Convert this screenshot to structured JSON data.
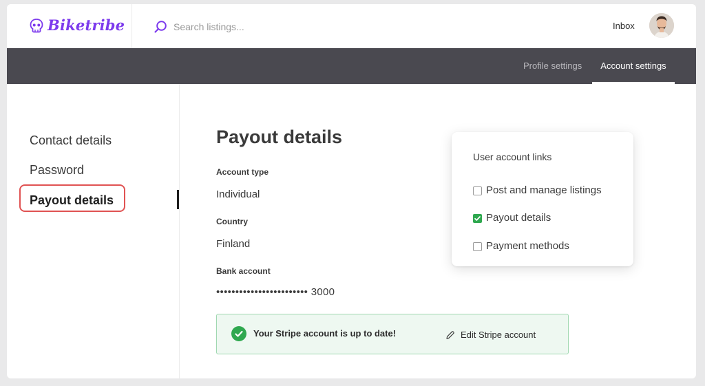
{
  "app": {
    "name": "Biketribe",
    "brand_color": "#7c3aed"
  },
  "search": {
    "placeholder": "Search listings..."
  },
  "topbar": {
    "inbox_label": "Inbox"
  },
  "subnav": {
    "tabs": [
      {
        "label": "Profile settings",
        "active": false
      },
      {
        "label": "Account settings",
        "active": true
      }
    ]
  },
  "sidebar": {
    "items": [
      {
        "label": "Contact details",
        "active": false
      },
      {
        "label": "Password",
        "active": false
      },
      {
        "label": "Payout details",
        "active": true
      }
    ]
  },
  "main": {
    "title": "Payout details",
    "fields": [
      {
        "label": "Account type",
        "value": "Individual"
      },
      {
        "label": "Country",
        "value": "Finland"
      },
      {
        "label": "Bank account",
        "value": "•••••••••••••••••••••••• 3000"
      }
    ],
    "stripe": {
      "message": "Your Stripe account is up to date!",
      "edit_label": "Edit Stripe account",
      "status_color": "#2fa84f"
    }
  },
  "popup": {
    "title": "User account links",
    "items": [
      {
        "label": "Post and manage listings",
        "checked": false
      },
      {
        "label": "Payout details",
        "checked": true
      },
      {
        "label": "Payment methods",
        "checked": false
      }
    ]
  }
}
